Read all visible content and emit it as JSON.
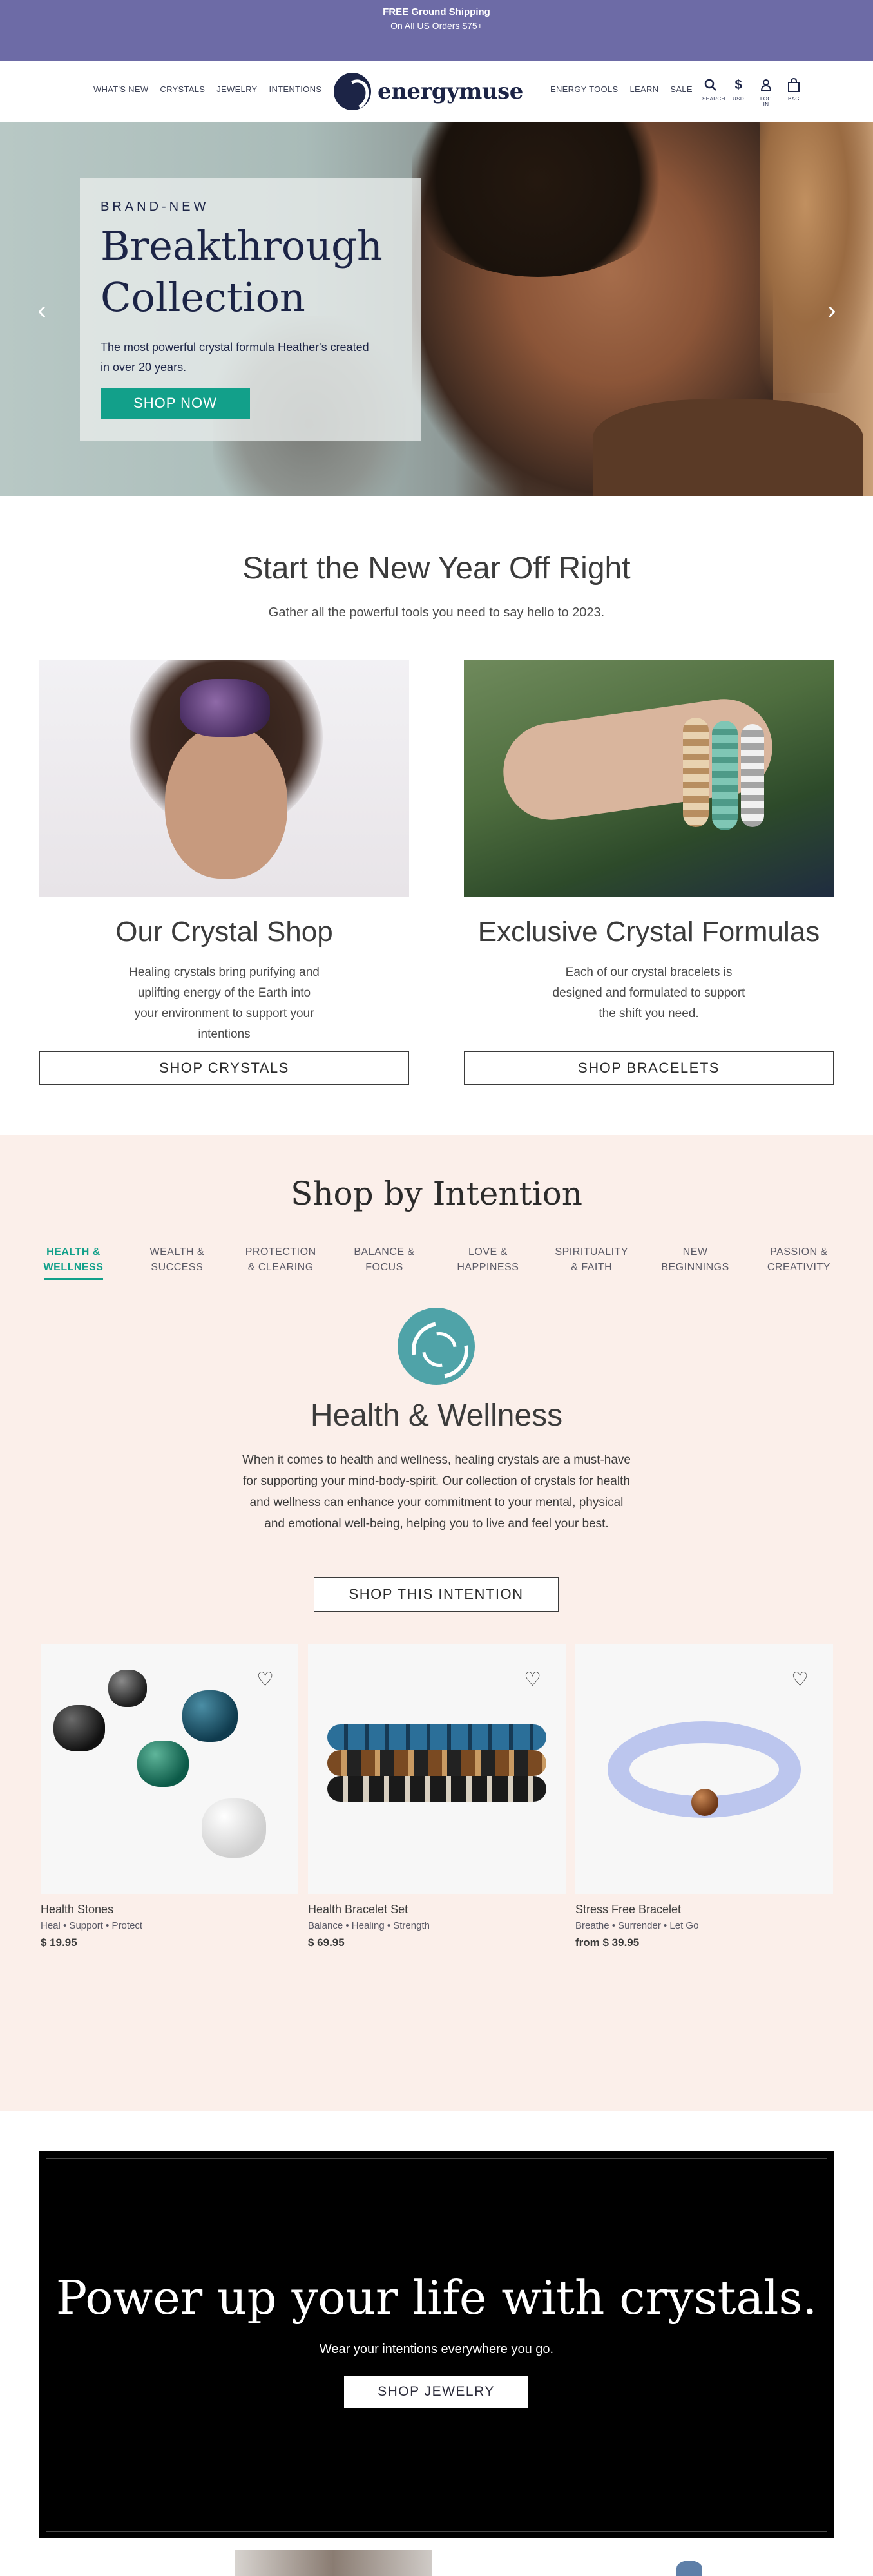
{
  "announcement": {
    "line1": "FREE Ground Shipping",
    "line2": "On All US Orders $75+"
  },
  "header": {
    "nav_left": [
      "WHAT'S NEW",
      "CRYSTALS",
      "JEWELRY",
      "INTENTIONS"
    ],
    "logo": "energymuse",
    "nav_right": [
      "ENERGY TOOLS",
      "LEARN",
      "SALE"
    ],
    "utils": [
      {
        "icon": "search-icon",
        "label": "SEARCH"
      },
      {
        "icon": "dollar-icon",
        "label": "USD"
      },
      {
        "icon": "user-icon",
        "label": "LOG IN"
      },
      {
        "icon": "bag-icon",
        "label": "BAG"
      }
    ]
  },
  "hero": {
    "eyebrow": "BRAND-NEW",
    "title_line1": "Breakthrough",
    "title_line2": "Collection",
    "description": "The most powerful crystal formula Heather's created in over 20 years.",
    "cta": "SHOP NOW",
    "prev": "‹",
    "next": "›"
  },
  "new_year": {
    "title": "Start the New Year Off Right",
    "subtitle": "Gather all the powerful tools you need to say hello to 2023.",
    "cards": [
      {
        "title": "Our Crystal Shop",
        "description": "Healing crystals bring purifying and uplifting energy of the Earth into your environment to support your intentions",
        "button": "SHOP CRYSTALS"
      },
      {
        "title": "Exclusive Crystal Formulas",
        "description": "Each of our crystal bracelets is designed and formulated to support the shift you need.",
        "button": "SHOP BRACELETS"
      }
    ]
  },
  "intention": {
    "title": "Shop by Intention",
    "tabs": [
      {
        "l1": "HEALTH &",
        "l2": "WELLNESS"
      },
      {
        "l1": "WEALTH &",
        "l2": "SUCCESS"
      },
      {
        "l1": "PROTECTION",
        "l2": "& CLEARING"
      },
      {
        "l1": "BALANCE &",
        "l2": "FOCUS"
      },
      {
        "l1": "LOVE &",
        "l2": "HAPPINESS"
      },
      {
        "l1": "SPIRITUALITY",
        "l2": "& FAITH"
      },
      {
        "l1": "NEW",
        "l2": "BEGINNINGS"
      },
      {
        "l1": "PASSION &",
        "l2": "CREATIVITY"
      }
    ],
    "heading": "Health & Wellness",
    "description": "When it comes to health and wellness, healing crystals are a must-have for supporting your mind-body-spirit. Our collection of crystals for health and wellness can enhance your commitment to your mental, physical and emotional well-being, helping you to live and feel your best.",
    "button": "SHOP THIS INTENTION",
    "products": [
      {
        "name": "Health Stones",
        "tags": "Heal • Support • Protect",
        "price": "$ 19.95"
      },
      {
        "name": "Health Bracelet Set",
        "tags": "Balance • Healing • Strength",
        "price": "$ 69.95"
      },
      {
        "name": "Stress Free Bracelet",
        "tags": "Breathe • Surrender • Let Go",
        "price": "from $ 39.95"
      }
    ]
  },
  "power": {
    "title": "Power up your life with crystals.",
    "subtitle": "Wear your intentions everywhere you go.",
    "button": "SHOP JEWELRY"
  },
  "colors": {
    "announce_bg": "#6d6ba6",
    "accent": "#12a08a",
    "navy": "#1c2446",
    "intention_bg": "#fbefea"
  }
}
